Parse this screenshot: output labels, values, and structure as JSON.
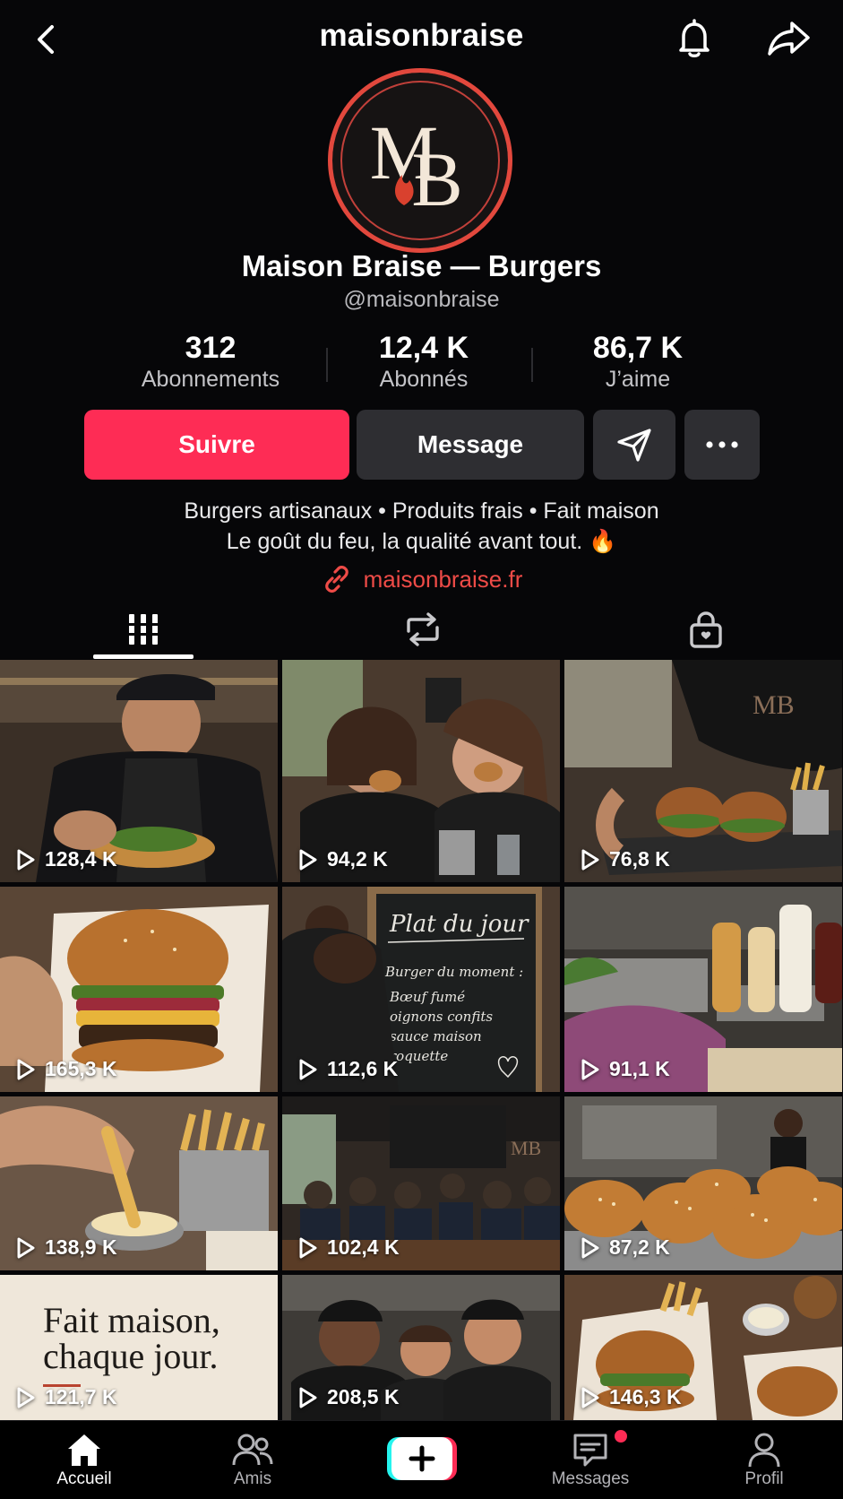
{
  "header": {
    "title": "maisonbraise"
  },
  "profile": {
    "display_name": "Maison Braise — Burgers",
    "handle": "@maisonbraise",
    "avatar_monogram": "MB",
    "stats": [
      {
        "value": "312",
        "label": "Abonnements"
      },
      {
        "value": "12,4 K",
        "label": "Abonnés"
      },
      {
        "value": "86,7 K",
        "label": "J’aime"
      }
    ],
    "bio_line1": "Burgers artisanaux • Produits frais • Fait maison",
    "bio_line2": "Le goût du feu, la qualité avant tout. 🔥",
    "link": "maisonbraise.fr"
  },
  "actions": {
    "follow_label": "Suivre",
    "message_label": "Message"
  },
  "tabs": [
    {
      "icon": "grid-icon",
      "active": true
    },
    {
      "icon": "repost-icon",
      "active": false
    },
    {
      "icon": "lock-icon",
      "active": false
    }
  ],
  "videos": [
    {
      "views": "128,4 K",
      "scene": "chef-garnishing-burger"
    },
    {
      "views": "94,2 K",
      "scene": "friends-eating-burgers"
    },
    {
      "views": "76,8 K",
      "scene": "server-with-burger-tray"
    },
    {
      "views": "165,3 K",
      "scene": "burger-closeup-wrapped"
    },
    {
      "views": "112,6 K",
      "scene": "chalkboard-plat-du-jour"
    },
    {
      "views": "91,1 K",
      "scene": "kitchen-prep-sauces"
    },
    {
      "views": "138,9 K",
      "scene": "fries-dipping-sauce"
    },
    {
      "views": "102,4 K",
      "scene": "busy-dining-room"
    },
    {
      "views": "87,2 K",
      "scene": "fresh-buns-tray"
    },
    {
      "views": "121,7 K",
      "scene": "fait-maison-text-card"
    },
    {
      "views": "208,5 K",
      "scene": "team-portrait"
    },
    {
      "views": "146,3 K",
      "scene": "table-burgers-overhead"
    }
  ],
  "chalkboard": {
    "title": "Plat du jour",
    "line1": "Burger du moment :",
    "line2": "Bœuf fumé",
    "line3": "oignons confits",
    "line4": "sauce maison",
    "line5": "roquette"
  },
  "text_card": {
    "line1": "Fait maison,",
    "line2": "chaque jour."
  },
  "bottom_nav": {
    "home": "Accueil",
    "friends": "Amis",
    "messages": "Messages",
    "profile": "Profil"
  },
  "colors": {
    "background": "#060608",
    "accent": "#fe2c55",
    "link": "#ee4b47",
    "button_secondary": "#2e2e32",
    "avatar_ring": "#e2483d"
  }
}
